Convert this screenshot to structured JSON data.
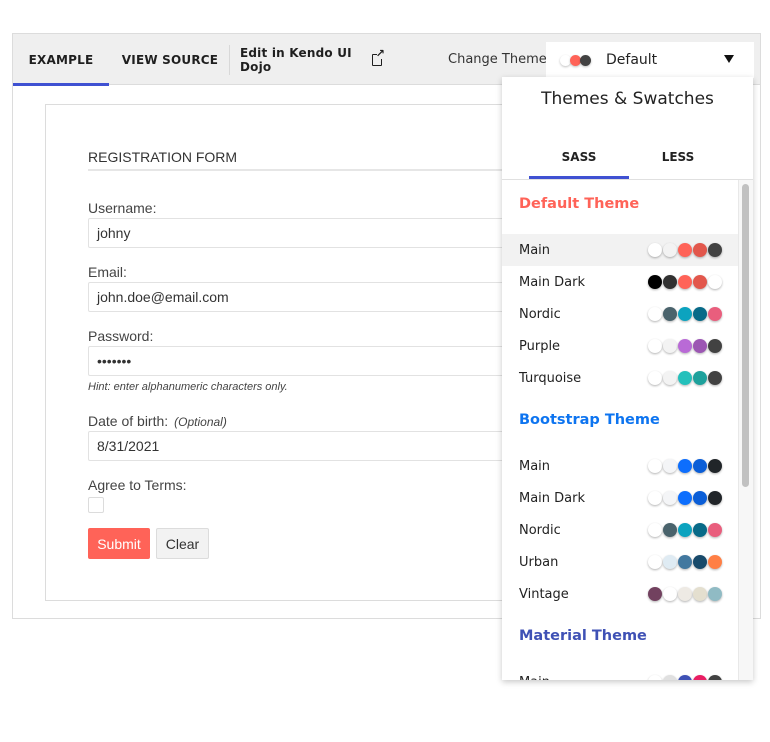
{
  "tabs": {
    "example": "EXAMPLE",
    "view_source": "VIEW SOURCE",
    "dojo": "Edit in Kendo UI Dojo",
    "dojo_icon": "external-link-icon"
  },
  "theme_picker": {
    "label": "Change Theme",
    "selected": "Default",
    "selected_swatches": [
      "#ffffff",
      "#ff6358",
      "#424242"
    ],
    "arrow_icon": "caret-down-icon"
  },
  "form": {
    "title": "REGISTRATION FORM",
    "username_label": "Username:",
    "username_value": "johny",
    "email_label": "Email:",
    "email_value": "john.doe@email.com",
    "password_label": "Password:",
    "password_value": "•••••••",
    "password_hint": "Hint: enter alphanumeric characters only.",
    "dob_label": "Date of birth:",
    "dob_optional": "(Optional)",
    "dob_value": "8/31/2021",
    "terms_label": "Agree to Terms:",
    "terms_checked": false,
    "submit_label": "Submit",
    "clear_label": "Clear"
  },
  "popup": {
    "title": "Themes & Swatches",
    "tabs": [
      "SASS",
      "LESS"
    ],
    "active_tab": "SASS",
    "groups": [
      {
        "title": "Default Theme",
        "color": "#ff6358",
        "items": [
          {
            "name": "Main",
            "selected": true,
            "swatches": [
              "#ffffff",
              "#f3f3f3",
              "#ff6358",
              "#e2574c",
              "#424242"
            ]
          },
          {
            "name": "Main Dark",
            "selected": false,
            "swatches": [
              "#000000",
              "#313131",
              "#ff6358",
              "#e2574c",
              "#ffffff"
            ]
          },
          {
            "name": "Nordic",
            "selected": false,
            "swatches": [
              "#ffffff",
              "#4a636c",
              "#0ca3bf",
              "#086a88",
              "#e95e7d"
            ]
          },
          {
            "name": "Purple",
            "selected": false,
            "swatches": [
              "#ffffff",
              "#f3f3f3",
              "#b96ad6",
              "#9c56b3",
              "#424242"
            ]
          },
          {
            "name": "Turquoise",
            "selected": false,
            "swatches": [
              "#ffffff",
              "#f3f3f3",
              "#24c0bb",
              "#1ea19c",
              "#424242"
            ]
          }
        ]
      },
      {
        "title": "Bootstrap Theme",
        "color": "#0d74f0",
        "items": [
          {
            "name": "Main",
            "selected": false,
            "swatches": [
              "#ffffff",
              "#f4f5f7",
              "#0d6efd",
              "#0b5ed7",
              "#212529"
            ]
          },
          {
            "name": "Main Dark",
            "selected": false,
            "swatches": [
              "#ffffff",
              "#f4f5f7",
              "#0d6efd",
              "#0b5ed7",
              "#212529"
            ]
          },
          {
            "name": "Nordic",
            "selected": false,
            "swatches": [
              "#ffffff",
              "#4a636c",
              "#0ca3bf",
              "#086a88",
              "#e95e7d"
            ]
          },
          {
            "name": "Urban",
            "selected": false,
            "swatches": [
              "#ffffff",
              "#dfebf3",
              "#42789f",
              "#184a6a",
              "#ff7f45"
            ]
          },
          {
            "name": "Vintage",
            "selected": false,
            "swatches": [
              "#72415f",
              "#ffffff",
              "#eeeae4",
              "#e4dfcf",
              "#90bbc4"
            ]
          }
        ]
      },
      {
        "title": "Material Theme",
        "color": "#3f51b5",
        "items": [
          {
            "name": "Main",
            "selected": false,
            "swatches": [
              "#ffffff",
              "#e0e0e0",
              "#3f51b5",
              "#e91e63",
              "#424242"
            ]
          }
        ]
      }
    ]
  }
}
